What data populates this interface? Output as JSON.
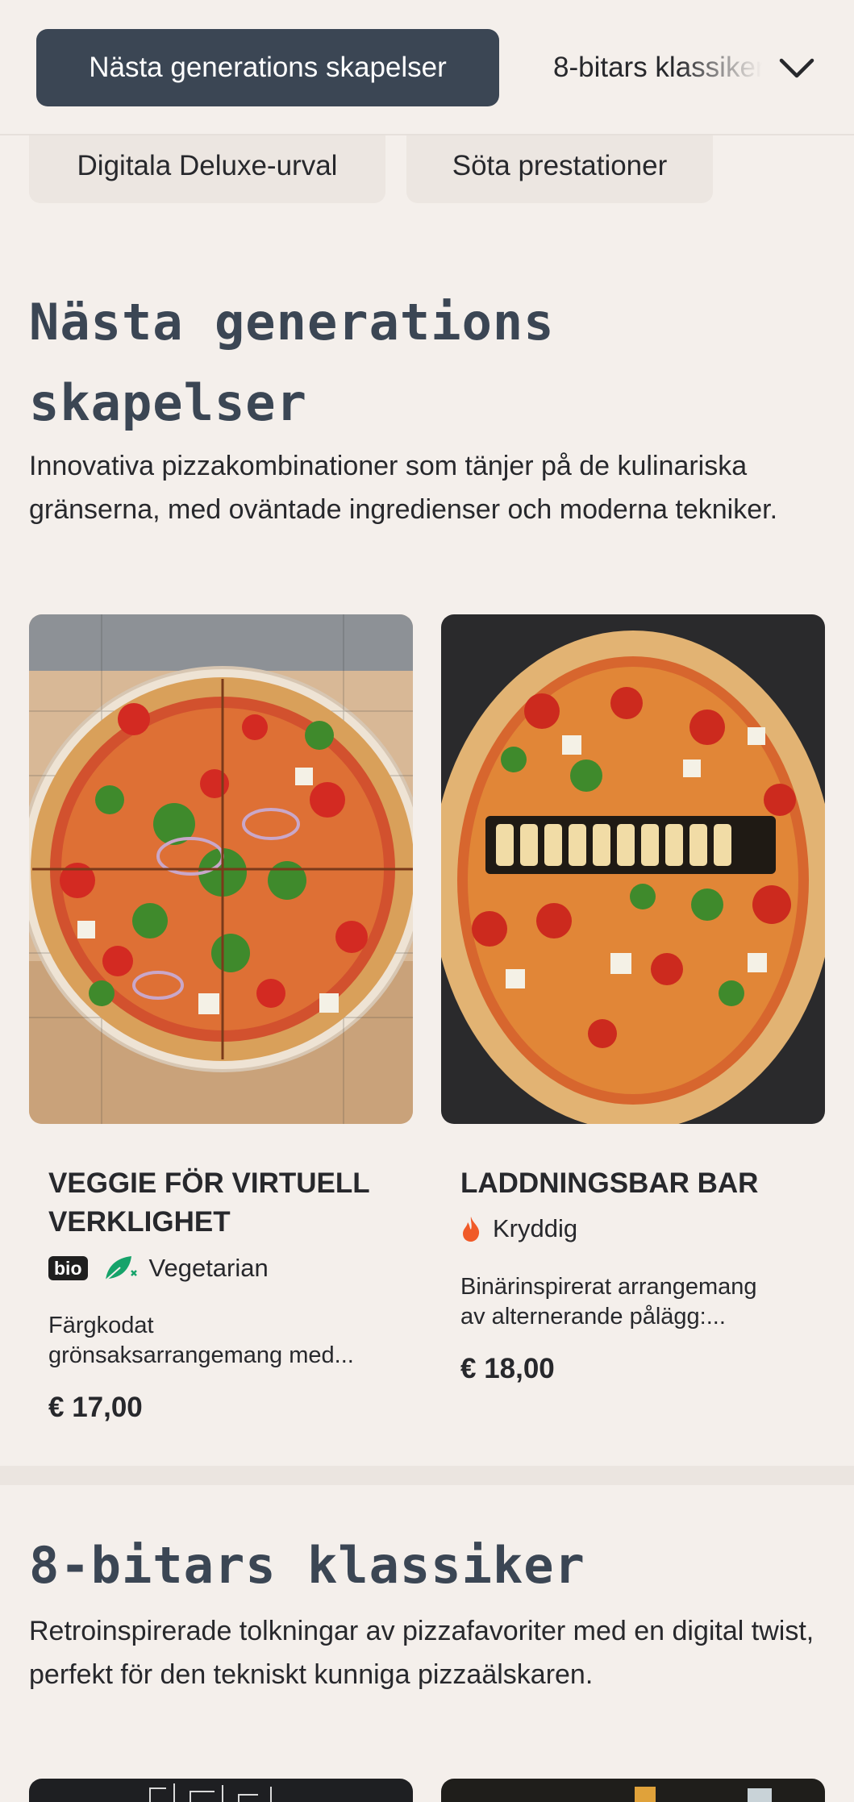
{
  "nav": {
    "active_chip": "Nästa generations skapelser",
    "next_chip": "8-bitars klassiker",
    "row2_chips": [
      "Digitala Deluxe-urval",
      "Söta prestationer"
    ]
  },
  "sections": [
    {
      "title_line1": "Nästa generations",
      "title_line2": "skapelser",
      "description": "Innovativa pizzakombinationer som tänjer på de kulinariska gränserna, med oväntade ingredienser och moderna tekniker.",
      "items": [
        {
          "title": "VEGGIE FÖR VIRTUELL VERKLIGHET",
          "bio_label": "bio",
          "tag": "Vegetarian",
          "description_line1": "Färgkodat",
          "description_line2": "grönsaksarrangemang med...",
          "price": "€ 17,00"
        },
        {
          "title": "LADDNINGSBAR BAR",
          "tag": "Kryddig",
          "description_line1": "Binärinspirerat arrangemang",
          "description_line2": "av alternerande pålägg:...",
          "price": "€ 18,00"
        }
      ]
    },
    {
      "title": "8-bitars klassiker",
      "description": "Retroinspirerade tolkningar av pizzafavoriter med en digital twist, perfekt för den tekniskt kunniga pizzaälskaren."
    }
  ],
  "icons": {
    "expand": "chevron-down-icon",
    "vegetarian": "leaf-icon",
    "spicy": "flame-icon"
  },
  "colors": {
    "background": "#f4efeb",
    "active_chip": "#3b4654",
    "title": "#3b4654",
    "vegetarian_green": "#16a36a",
    "spicy_orange": "#f05a28"
  }
}
